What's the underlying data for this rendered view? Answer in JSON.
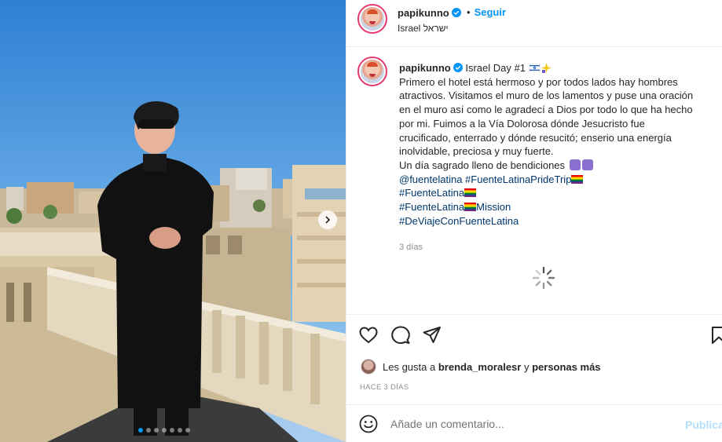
{
  "post": {
    "username": "papikunno",
    "follow_label": "Seguir",
    "bullet": "•",
    "location": "Israel ישראל",
    "caption": {
      "title": "Israel Day #1",
      "body_lines": [
        "Primero el hotel está hermoso y por todos lados hay hombres",
        "atractivos. Visitamos el muro de los lamentos y puse una oración",
        "en el muro así como le agradecí a Dios por todo lo que ha hecho",
        "por mi. Fuimos a la Vía Dolorosa dónde Jesucristo fue",
        "crucificado, enterrado y dónde resucitó; enserio una energía",
        "inolvidable, preciosa y muy fuerte."
      ],
      "blessing": "Un día sagrado lleno de bendiciones",
      "mentions": [
        "@fuentelatina",
        "#FuenteLatinaPrideTrip"
      ],
      "hashtag_2": "#FuenteLatina",
      "hashtag_3a": "#FuenteLatina",
      "hashtag_3b": "Mission",
      "hashtag_4": "#DeViajeConFuenteLatina"
    },
    "time_ago": "3 días",
    "likes": {
      "prefix": "Les gusta a",
      "user": "brenda_moralesr",
      "connector": "y",
      "others": "personas más"
    },
    "posted": "HACE 3 DÍAS",
    "comment": {
      "placeholder": "Añade un comentario...",
      "post_label": "Publica"
    },
    "carousel": {
      "count": 7,
      "active_index": 0
    },
    "colors": {
      "accent": "#0095f6",
      "verified": "#0095f6",
      "hashtag": "#00376b",
      "post_disabled": "#b2dffc",
      "sky": "#3f8fd8"
    },
    "icons": [
      "verified-icon",
      "heart-icon",
      "comment-icon",
      "share-icon",
      "bookmark-icon",
      "emoji-icon",
      "chevron-right-icon",
      "loading-spinner-icon"
    ]
  }
}
